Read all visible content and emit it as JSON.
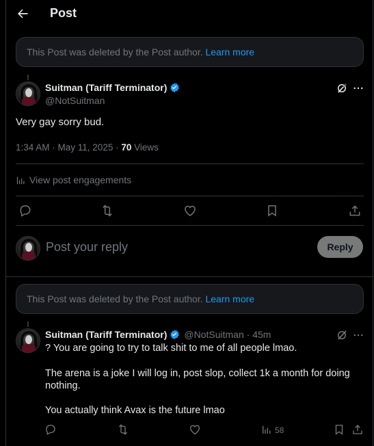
{
  "header": {
    "title": "Post"
  },
  "deleted_notice": {
    "text": "This Post was deleted by the Post author.",
    "link": "Learn more"
  },
  "main_post": {
    "author_name": "Suitman (Tariff Terminator)",
    "author_handle": "@NotSuitman",
    "text": "Very gay sorry bud.",
    "timestamp": "1:34 AM · May 11, 2025 · ",
    "views_count": "70",
    "views_label": " Views",
    "engagements_link": "View post engagements"
  },
  "reply_box": {
    "placeholder": "Post your reply",
    "button": "Reply"
  },
  "deleted_notice_2": {
    "text": "This Post was deleted by the Post author.",
    "link": "Learn more"
  },
  "second_post": {
    "author_name": "Suitman (Tariff Terminator)",
    "author_handle": "@NotSuitman",
    "time": " · 45m",
    "lines": [
      "? You are going to try to talk shit to me of all people lmao.",
      "The arena is a joke I will log in, post slop, collect 1k a month for doing",
      "nothing.",
      "You actually think Avax is the future lmao"
    ],
    "views_count": "58"
  },
  "colors": {
    "accent": "#1d9bf0",
    "muted": "#71767b",
    "text": "#e7e9ea",
    "border": "#2f3336"
  }
}
